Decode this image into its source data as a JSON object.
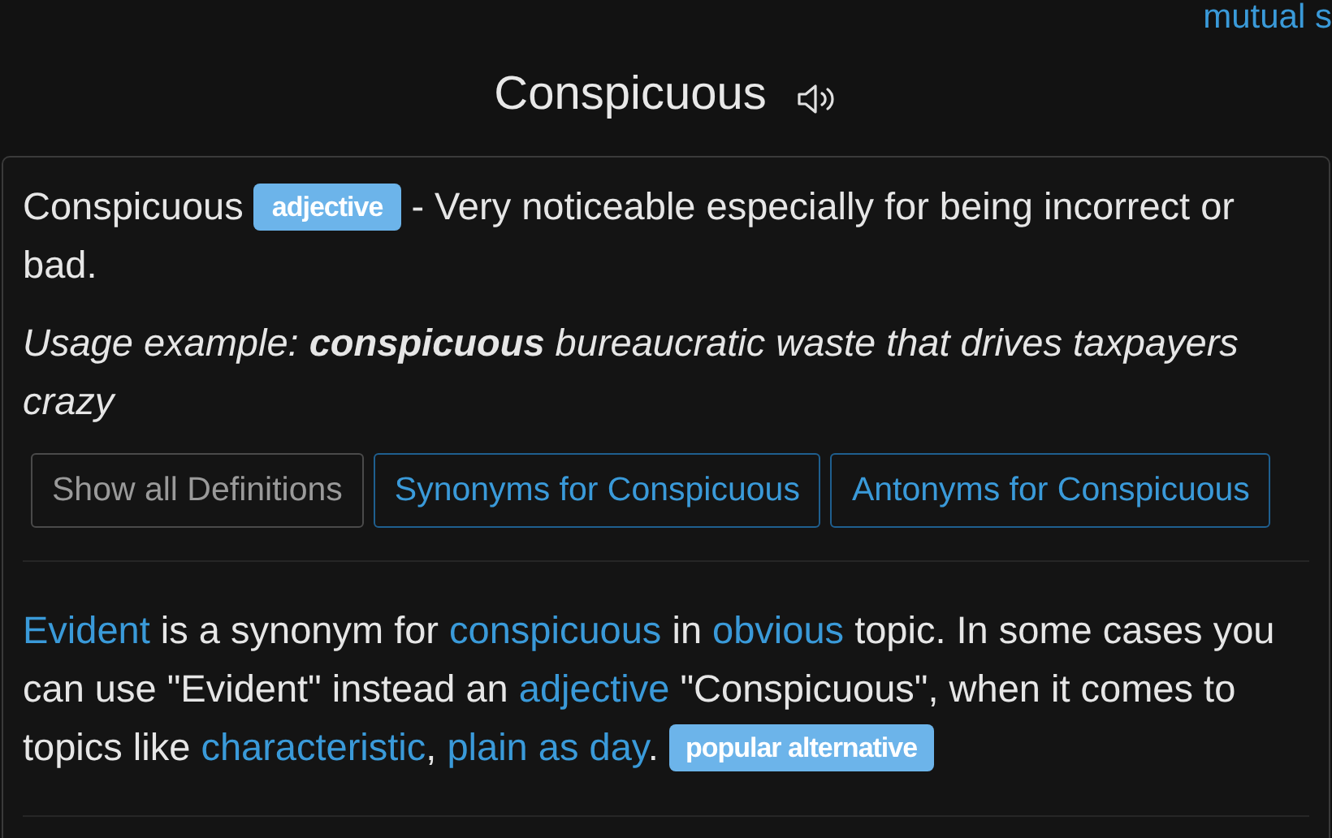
{
  "top_link": "mutual s",
  "title": "Conspicuous",
  "definition": {
    "word": "Conspicuous",
    "badge": "adjective",
    "text": "- Very noticeable especially for being incorrect or bad."
  },
  "example": "Usage example: **conspicuous** bureaucratic waste that drives taxpayers crazy",
  "buttons": [
    {
      "label": "Show all Definitions",
      "kind": "plain"
    },
    {
      "label": "Synonyms for Conspicuous",
      "kind": "link"
    },
    {
      "label": "Antonyms for Conspicuous",
      "kind": "link"
    }
  ],
  "synonym_paragraph": [
    {
      "kind": "link",
      "text": "Evident"
    },
    {
      "kind": "text",
      "text": " is a synonym for "
    },
    {
      "kind": "link",
      "text": "conspicuous"
    },
    {
      "kind": "text",
      "text": " in "
    },
    {
      "kind": "link",
      "text": "obvious"
    },
    {
      "kind": "text",
      "text": " topic. In some cases you can use \"Evident\" instead an "
    },
    {
      "kind": "link",
      "text": "adjective"
    },
    {
      "kind": "text",
      "text": " \"Conspicuous\", when it comes to topics like "
    },
    {
      "kind": "link",
      "text": "characteristic"
    },
    {
      "kind": "text",
      "text": ", "
    },
    {
      "kind": "link",
      "text": "plain as day"
    },
    {
      "kind": "text",
      "text": ". "
    },
    {
      "kind": "badge",
      "text": "popular alternative"
    }
  ]
}
